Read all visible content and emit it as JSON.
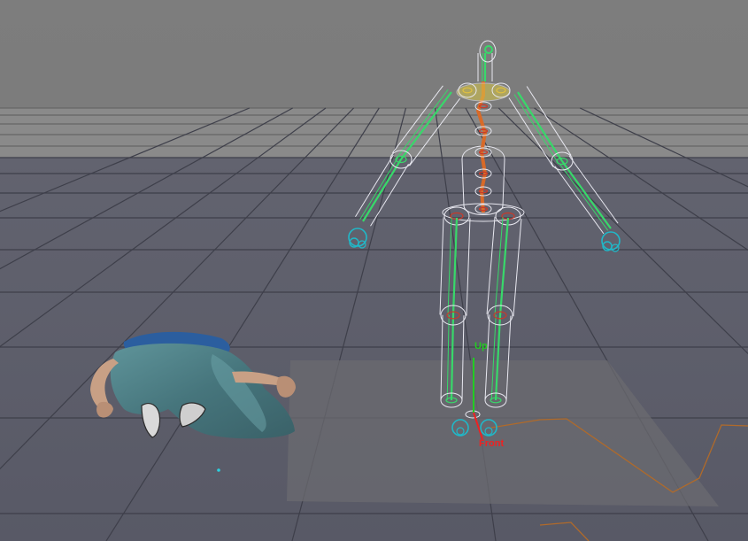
{
  "viewport": {
    "gizmo": {
      "up_label": "Up",
      "front_label": "Front",
      "up_color": "#22cc22",
      "front_color": "#ee2222"
    },
    "colors": {
      "sky": "#7b7b7b",
      "floor": "#5b5c6b",
      "grid_line": "#3f404c",
      "shadow_plane": "#6a6a6e",
      "skeleton_wire": "#e8e8f0",
      "bone_green": "#38d86a",
      "joint_cyan": "#20b8c8",
      "spine_orange": "#d86a28",
      "path_line": "#b06a2a",
      "jeans": "#4e7f86",
      "shirt": "#2a5ea0",
      "skin": "#c49a7c"
    }
  }
}
